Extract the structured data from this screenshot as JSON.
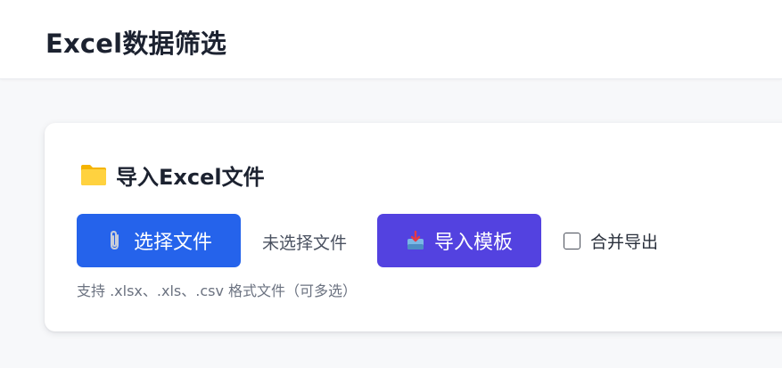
{
  "header": {
    "title": "Excel数据筛选"
  },
  "import_section": {
    "title": "导入Excel文件",
    "title_icon": "folder-icon",
    "choose_button": {
      "label": "选择文件",
      "icon": "paperclip-icon"
    },
    "no_file_text": "未选择文件",
    "template_button": {
      "label": "导入模板",
      "icon": "inbox-tray-icon"
    },
    "merge_export": {
      "label": "合并导出",
      "checked": false
    },
    "hint": "支持 .xlsx、.xls、.csv 格式文件（可多选）"
  },
  "colors": {
    "primary_blue": "#2563eb",
    "template_purple": "#5342e0",
    "page_background": "#f7f8fa"
  }
}
